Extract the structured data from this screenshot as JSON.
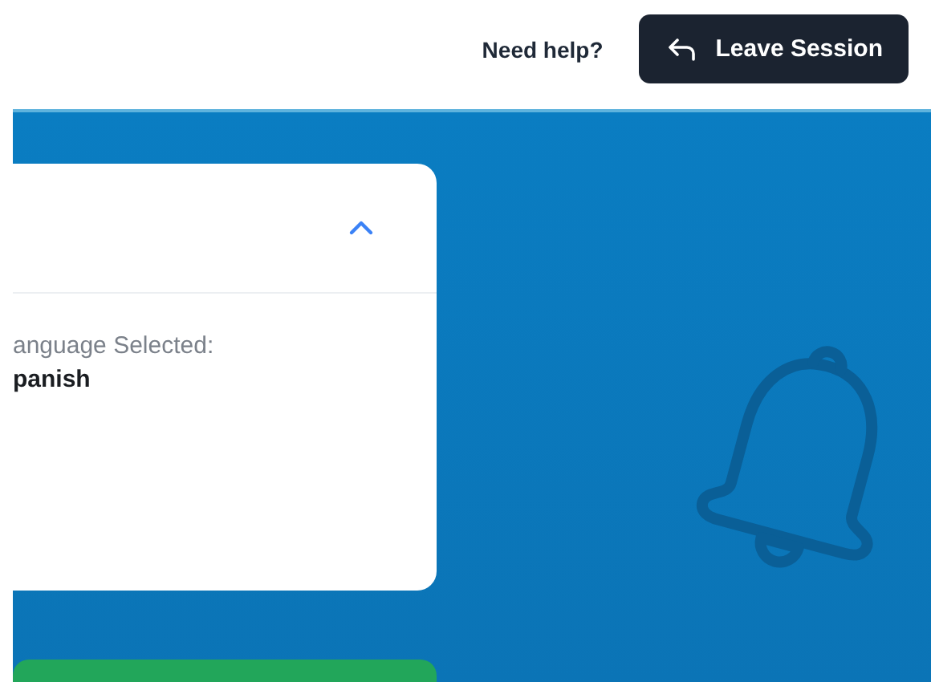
{
  "header": {
    "help_link": "Need help?",
    "leave_button": "Leave Session"
  },
  "card": {
    "expanded": true,
    "label": "anguage Selected:",
    "value": "panish"
  },
  "action_bar": {
    "kind": "button"
  }
}
